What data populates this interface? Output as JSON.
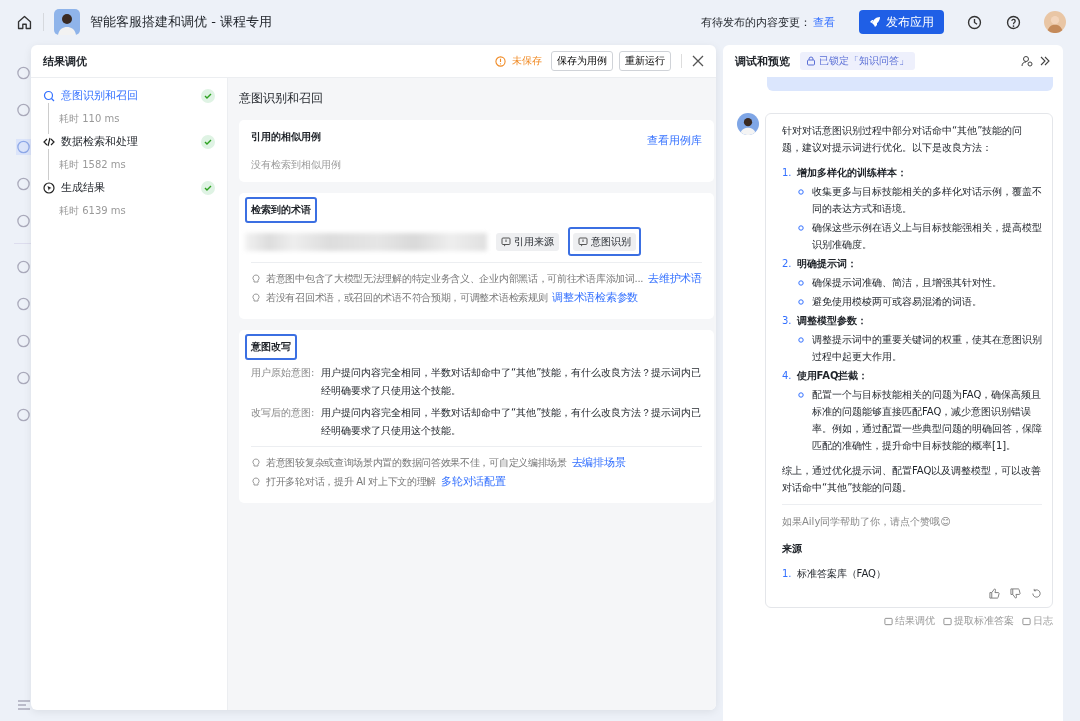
{
  "topbar": {
    "title": "智能客服搭建和调优 - 课程专用",
    "pending_label": "有待发布的内容变更：",
    "view_link": "查看",
    "publish_button": "发布应用"
  },
  "tuning": {
    "title": "结果调优",
    "unsaved": "未保存",
    "buttons": [
      "保存为用例",
      "重新运行"
    ],
    "steps": [
      {
        "label": "意图识别和召回",
        "time": "耗时 110 ms",
        "done": true,
        "selected": true,
        "kind": "recall"
      },
      {
        "label": "数据检索和处理",
        "time": "耗时 1582 ms",
        "done": true,
        "selected": false,
        "kind": "code"
      },
      {
        "label": "生成结果",
        "time": "耗时 6139 ms",
        "done": true,
        "selected": false,
        "kind": "generate"
      }
    ],
    "section_title": "意图识别和召回",
    "cases": {
      "title": "引用的相似用例",
      "link": "查看用例库",
      "empty": "没有检索到相似用例"
    },
    "terms": {
      "title": "检索到的术语",
      "highlighted": true,
      "tags": [
        {
          "label": "引用来源",
          "highlighted": false
        },
        {
          "label": "意图识别",
          "highlighted": true
        }
      ],
      "tips": [
        {
          "text": "若意图中包含了大模型无法理解的特定业务含义、企业内部黑话，可前往术语库添加词...",
          "link": "去维护术语"
        },
        {
          "text": "若没有召回术语，或召回的术语不符合预期，可调整术语检索规则",
          "link": "调整术语检索参数"
        }
      ]
    },
    "rewrite": {
      "title": "意图改写",
      "highlighted": true,
      "rows": [
        {
          "label": "用户原始意图:",
          "text": "用户提问内容完全相同，半数对话却命中了“其他”技能，有什么改良方法？提示词内已经明确要求了只使用这个技能。"
        },
        {
          "label": "改写后的意图:",
          "text": "用户提问内容完全相同，半数对话却命中了“其他”技能，有什么改良方法？提示词内已经明确要求了只使用这个技能。"
        }
      ],
      "tips": [
        {
          "text": "若意图较复杂或查询场景内置的数据问答效果不佳，可自定义编排场景",
          "link": "去编排场景"
        },
        {
          "text": "打开多轮对话，提升 AI 对上下文的理解",
          "link": "多轮对话配置"
        }
      ]
    }
  },
  "preview": {
    "title": "调试和预览",
    "lock_badge": "已锁定「知识问答」",
    "intro": "针对对话意图识别过程中部分对话命中“其他”技能的问题，建议对提示词进行优化。以下是改良方法：",
    "items": [
      {
        "num": "1.",
        "title": "增加多样化的训练样本：",
        "bullets": [
          "收集更多与目标技能相关的多样化对话示例，覆盖不同的表达方式和语境。",
          "确保这些示例在语义上与目标技能强相关，提高模型识别准确度。"
        ]
      },
      {
        "num": "2.",
        "title": "明确提示词：",
        "bullets": [
          "确保提示词准确、简洁，且增强其针对性。",
          "避免使用模棱两可或容易混淆的词语。"
        ]
      },
      {
        "num": "3.",
        "title": "调整模型参数：",
        "bullets": [
          "调整提示词中的重要关键词的权重，使其在意图识别过程中起更大作用。"
        ]
      },
      {
        "num": "4.",
        "title": "使用FAQ拦截：",
        "bullets": [
          "配置一个与目标技能相关的问题为FAQ，确保高频且标准的问题能够直接匹配FAQ，减少意图识别错误率。例如，通过配置一些典型问题的明确回答，保障匹配的准确性，提升命中目标技能的概率[1]。"
        ]
      }
    ],
    "summary": "综上，通过优化提示词、配置FAQ以及调整模型，可以改善对话命中“其他”技能的问题。",
    "feedback_prompt": "如果Aily同学帮助了你，请点个赞哦😊",
    "sources_title": "来源",
    "sources": [
      {
        "num": "1.",
        "text": "标准答案库（FAQ）"
      }
    ],
    "footer_actions": [
      "结果调优",
      "提取标准答案",
      "日志"
    ]
  }
}
